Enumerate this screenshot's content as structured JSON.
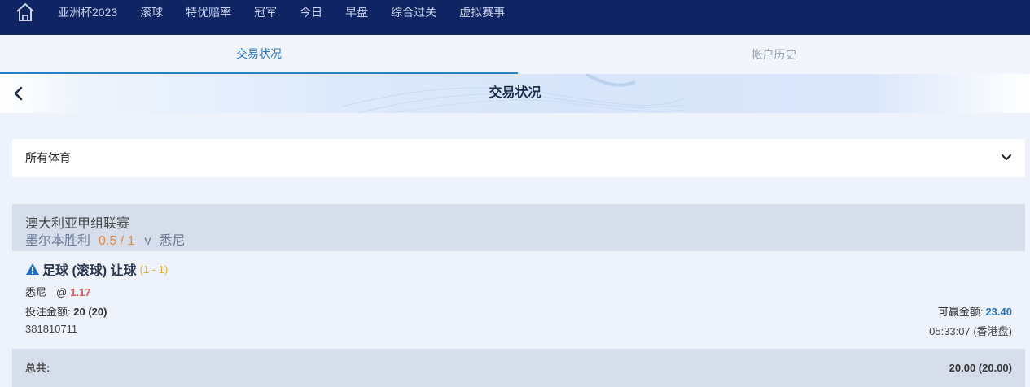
{
  "nav": {
    "items": [
      "亚洲杯2023",
      "滚球",
      "特优赔率",
      "冠军",
      "今日",
      "早盘",
      "综合过关",
      "虚拟赛事"
    ],
    "home_icon": "home-icon"
  },
  "tabs": {
    "active": "交易状况",
    "inactive": "帐户历史"
  },
  "header": {
    "title": "交易状况",
    "back_icon": "chevron-left-icon"
  },
  "filter": {
    "sport": "所有体育",
    "icon": "chevron-down-icon"
  },
  "league": {
    "name": "澳大利亚甲组联赛",
    "home": "墨尔本胜利",
    "handicap": "0.5 / 1",
    "vs": "v",
    "away": "悉尼"
  },
  "bet": {
    "title": "足球 (滚球) 让球",
    "score": "(1 - 1)",
    "selection": "悉尼",
    "at": "@",
    "odds": "1.17",
    "stake_label": "投注金额:",
    "stake_value": "20 (20)",
    "winnings_label": "可赢金额:",
    "winnings_value": "23.40",
    "id": "381810711",
    "time": "05:33:07 (香港盘)"
  },
  "total": {
    "label": "总共:",
    "value": "20.00 (20.00)"
  },
  "colors": {
    "nav_bg": "#0f2563",
    "accent": "#2276c9",
    "handicap": "#e58a3b",
    "odds": "#e05a5a",
    "score": "#e6b020"
  }
}
